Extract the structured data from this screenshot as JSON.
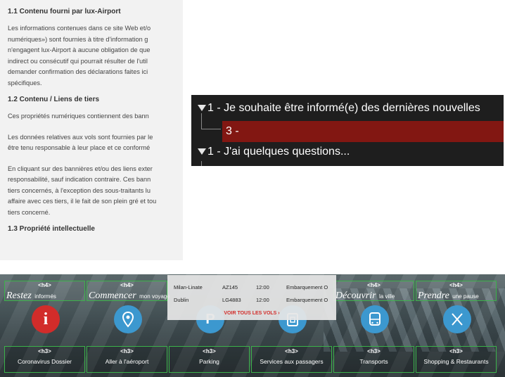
{
  "legal": {
    "section_1_1": {
      "heading": "1.1 Contenu fourni par lux-Airport",
      "lines": [
        "Les informations contenues dans ce site Web et/o",
        "numériques») sont fournies à titre d'information g",
        "n'engagent lux-Airport à aucune obligation de que",
        "indirect ou consécutif qui pourrait résulter de l'util",
        "demander confirmation des déclarations faites ici",
        "spécifiques."
      ]
    },
    "section_1_2": {
      "heading": "1.2 Contenu / Liens de tiers",
      "p1": [
        "Ces propriétés numériques contiennent des bann"
      ],
      "p2": [
        "Les données relatives aux vols sont fournies par le",
        "être tenu responsable à leur place et ce conformé"
      ],
      "p3": [
        "En cliquant sur des bannières et/ou des liens exter",
        "responsabilité, sauf indication contraire. Ces bann",
        "tiers concernés, à l'exception des sous-traitants lu",
        "affaire avec ces tiers, il le fait de son plein gré et tou",
        "tiers concerné."
      ]
    },
    "section_1_3": {
      "heading": "1.3 Propriété intellectuelle"
    }
  },
  "tree": {
    "row1": "1 - Je souhaite être informé(e) des dernières nouvelles",
    "row2": "3 -",
    "row3": "1 - J'ai quelques questions...",
    "highlight_color": "#821712"
  },
  "airport": {
    "accent_green": "#3bb24a",
    "accent_blue": "#3c98cf",
    "accent_red": "#d22c2a",
    "h4_tag": "<h4>",
    "h3_tag": "<h3>",
    "cards": [
      {
        "h4_big": "Restez",
        "h4_small": "informés",
        "icon": "info-icon",
        "glyph": "i",
        "h3": "Coronavirus Dossier"
      },
      {
        "h4_big": "Commencer",
        "h4_small": "mon voyage",
        "icon": "location-pin-icon",
        "glyph": "⚲",
        "h3": "Aller à l'aéroport"
      },
      {
        "h4_big": "",
        "h4_small": "",
        "icon": "parking-icon",
        "glyph": "P",
        "h3": "Parking"
      },
      {
        "h4_big": "",
        "h4_small": "",
        "icon": "passenger-services-icon",
        "glyph": "⎙",
        "h3": "Services aux passagers"
      },
      {
        "h4_big": "Découvrir",
        "h4_small": "la ville",
        "icon": "bus-icon",
        "glyph": "⊟",
        "h3": "Transports"
      },
      {
        "h4_big": "Prendre",
        "h4_small": "une pause",
        "icon": "fork-knife-icon",
        "glyph": "✕",
        "h3": "Shopping & Restaurants"
      }
    ],
    "flights": [
      {
        "city": "Milan-Linate",
        "code": "AZ145",
        "time": "12:00",
        "status": "Embarquement O"
      },
      {
        "city": "Dublin",
        "code": "LG4883",
        "time": "12:00",
        "status": "Embarquement O"
      }
    ],
    "all_flights_label": "VOIR TOUS LES VOLS ›"
  }
}
